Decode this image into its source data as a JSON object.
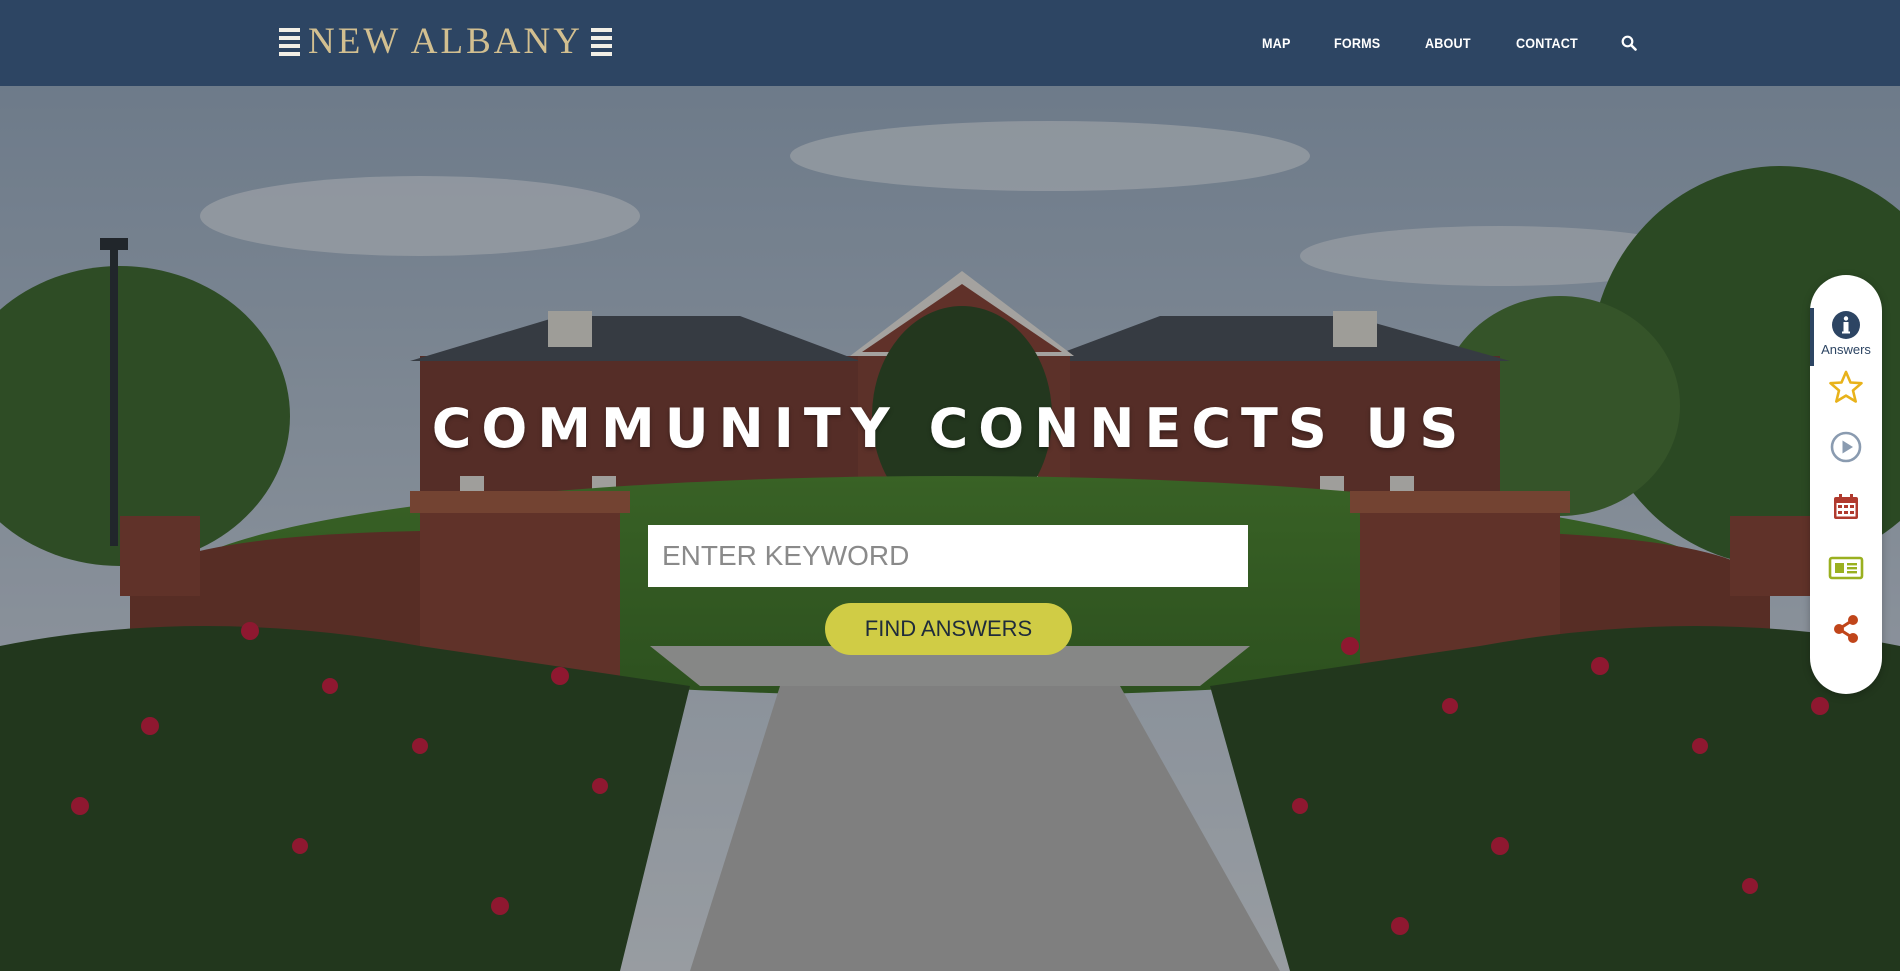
{
  "brand": {
    "name": "NEW ALBANY",
    "color": "#d2bf90",
    "bar_color": "#2d4563"
  },
  "nav": {
    "items": [
      {
        "label": "MAP"
      },
      {
        "label": "FORMS"
      },
      {
        "label": "ABOUT"
      },
      {
        "label": "CONTACT"
      }
    ],
    "search_icon": "search-icon"
  },
  "hero": {
    "headline": "COMMUNITY CONNECTS US",
    "search": {
      "placeholder": "ENTER KEYWORD",
      "value": ""
    },
    "button_label": "FIND ANSWERS",
    "button_color": "#d0cc45"
  },
  "toolbar": {
    "items": [
      {
        "icon": "info-icon",
        "label": "Answers",
        "active": true,
        "color": "#2d4563"
      },
      {
        "icon": "star-icon",
        "color": "#e8b21a"
      },
      {
        "icon": "play-icon",
        "color": "#8a9bb0"
      },
      {
        "icon": "calendar-icon",
        "color": "#b03a2e"
      },
      {
        "icon": "newspaper-icon",
        "color": "#9ab020"
      },
      {
        "icon": "share-icon",
        "color": "#c0451a"
      }
    ]
  }
}
